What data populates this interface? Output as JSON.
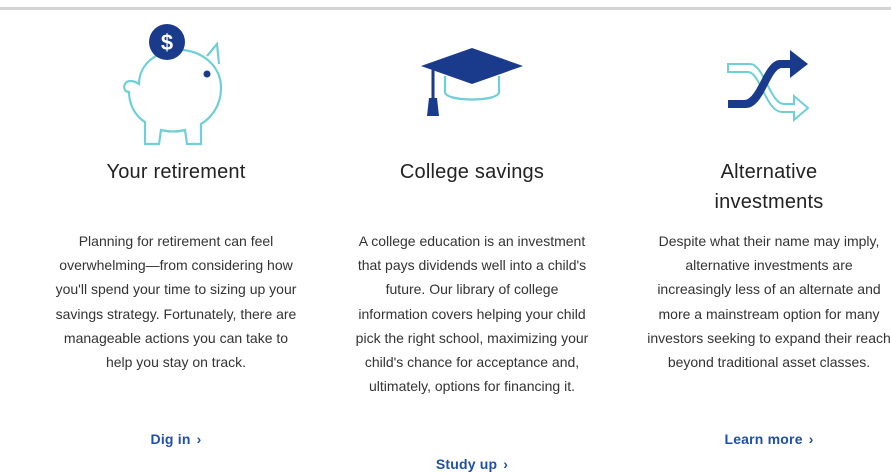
{
  "colors": {
    "accent": "#1f4fa8",
    "icon_navy": "#1a3a8c",
    "icon_teal": "#6ecfd8",
    "rule": "#d3d3d3"
  },
  "cards": [
    {
      "icon": "piggy-bank-dollar-icon",
      "title": "Your retirement",
      "body": "Planning for retirement can feel overwhelming—from considering how you'll spend your time to sizing up your savings strategy. Fortunately, there are manageable actions you can take to help you stay on track.",
      "link": "Dig in",
      "link_icon": "chevron-right-icon"
    },
    {
      "icon": "graduation-cap-icon",
      "title": "College savings",
      "body": "A college education is an investment that pays dividends well into a child's future. Our library of college information covers helping your child pick the right school, maximizing your child's chance for acceptance and, ultimately, options for financing it.",
      "link": "Study up",
      "link_icon": "chevron-right-icon"
    },
    {
      "icon": "shuffle-arrows-icon",
      "title": "Alternative investments",
      "body": "Despite what their name may imply, alternative investments are increasingly less of an alternate and more a mainstream option for many investors seeking to expand their reach beyond traditional asset classes.",
      "link": "Learn more",
      "link_icon": "chevron-right-icon"
    }
  ]
}
